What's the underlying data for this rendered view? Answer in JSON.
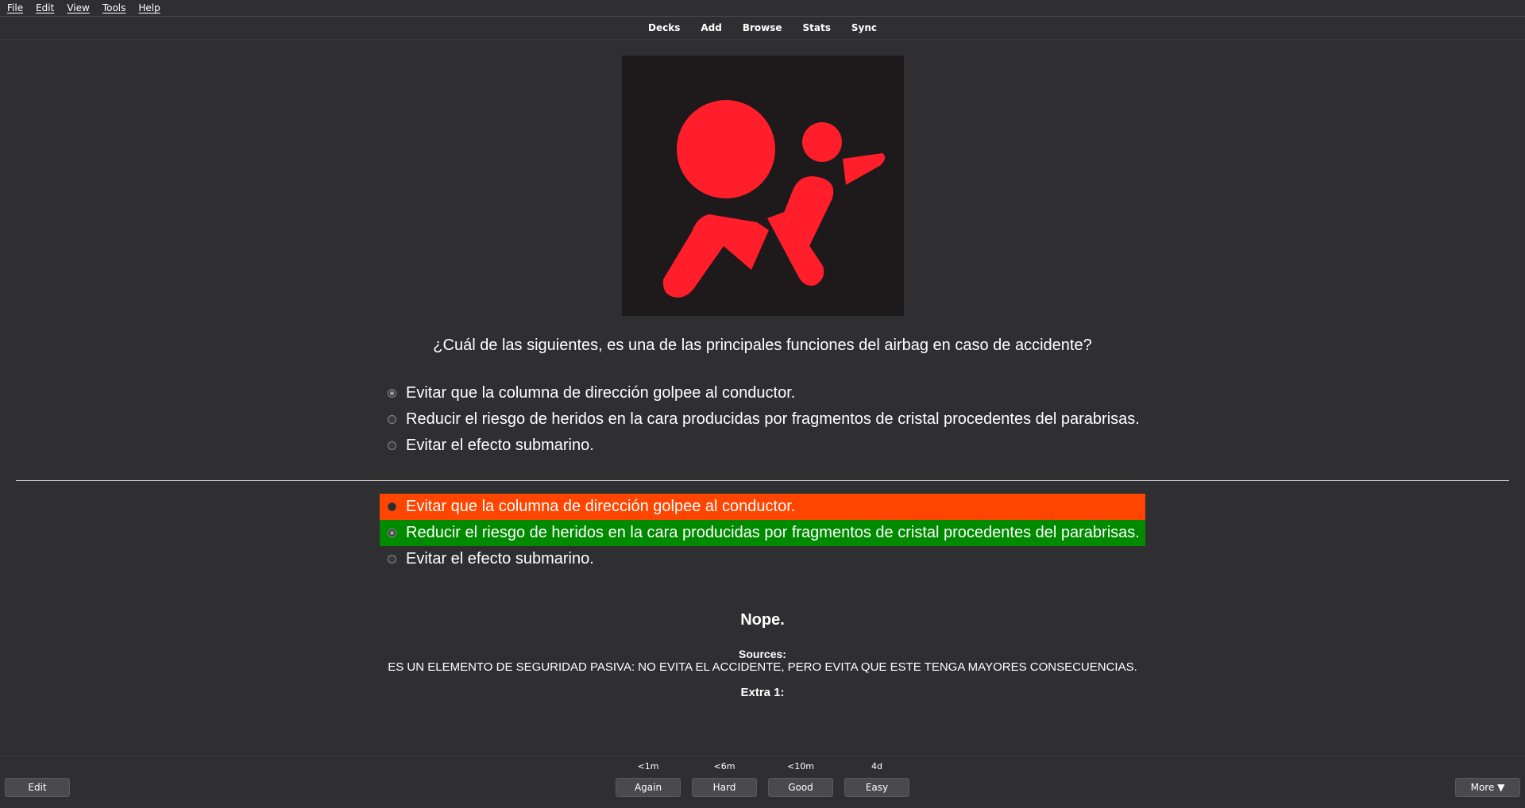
{
  "menu": [
    "File",
    "Edit",
    "View",
    "Tools",
    "Help"
  ],
  "nav": [
    "Decks",
    "Add",
    "Browse",
    "Stats",
    "Sync"
  ],
  "card": {
    "image_icon": "airbag-warning-icon",
    "question": "¿Cuál de las siguientes, es una de las principales funciones del airbag en caso de accidente?",
    "options": [
      "Evitar que la columna de dirección golpee al conductor.",
      "Reducir el riesgo de heridos en la cara producidas por fragmentos de cristal procedentes del parabrisas.",
      "Evitar el efecto submarino."
    ],
    "selected_index": 0,
    "correct_index": 1,
    "verdict": "Nope.",
    "sources_label": "Sources:",
    "sources_text": "ES UN ELEMENTO DE SEGURIDAD PASIVA: NO EVITA EL ACCIDENTE, PERO EVITA QUE ESTE TENGA MAYORES CONSECUENCIAS.",
    "extra_label": "Extra 1:"
  },
  "bottom": {
    "edit": "Edit",
    "more": "More ▼",
    "ease": [
      {
        "interval": "<1m",
        "label": "Again"
      },
      {
        "interval": "<6m",
        "label": "Hard"
      },
      {
        "interval": "<10m",
        "label": "Good"
      },
      {
        "interval": "4d",
        "label": "Easy"
      }
    ]
  },
  "colors": {
    "background": "#2f2f31",
    "wrong": "#ff4500",
    "correct": "#008a00",
    "icon_red": "#ff1e2a"
  }
}
